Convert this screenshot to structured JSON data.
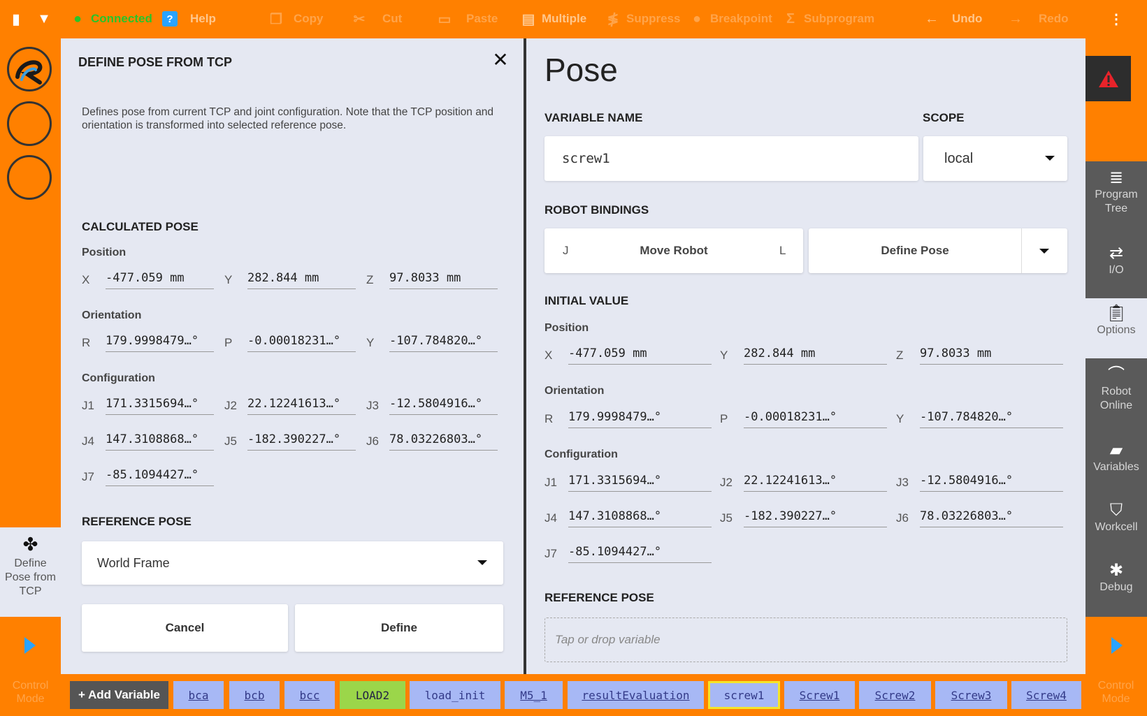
{
  "toolbar": {
    "connected": "Connected",
    "help": "Help",
    "copy": "Copy",
    "cut": "Cut",
    "paste": "Paste",
    "multiple": "Multiple",
    "suppress": "Suppress",
    "breakpoint": "Breakpoint",
    "subprogram": "Subprogram",
    "undo": "Undo",
    "redo": "Redo"
  },
  "left_rail": {
    "define_pose_label": "Define Pose from TCP",
    "control_mode": "Control Mode"
  },
  "dialog": {
    "title": "DEFINE POSE FROM TCP",
    "description": "Defines pose from current TCP and joint configuration. Note that the TCP position and orientation is transformed into selected reference pose.",
    "calculated_pose": "CALCULATED POSE",
    "position_label": "Position",
    "orientation_label": "Orientation",
    "configuration_label": "Configuration",
    "position": [
      {
        "label": "X",
        "value": "-477.059 mm"
      },
      {
        "label": "Y",
        "value": "282.844 mm"
      },
      {
        "label": "Z",
        "value": "97.8033 mm"
      }
    ],
    "orientation": [
      {
        "label": "R",
        "value": "179.9998479…°"
      },
      {
        "label": "P",
        "value": "-0.00018231…°"
      },
      {
        "label": "Y",
        "value": "-107.784820…°"
      }
    ],
    "configuration": [
      {
        "label": "J1",
        "value": "171.3315694…°"
      },
      {
        "label": "J2",
        "value": "22.12241613…°"
      },
      {
        "label": "J3",
        "value": "-12.5804916…°"
      },
      {
        "label": "J4",
        "value": "147.3108868…°"
      },
      {
        "label": "J5",
        "value": "-182.390227…°"
      },
      {
        "label": "J6",
        "value": "78.03226803…°"
      },
      {
        "label": "J7",
        "value": "-85.1094427…°"
      }
    ],
    "reference_pose_label": "REFERENCE POSE",
    "reference_pose_value": "World Frame",
    "cancel": "Cancel",
    "define": "Define"
  },
  "panel": {
    "title": "Pose",
    "variable_name_label": "VARIABLE NAME",
    "variable_name": "screw1",
    "scope_label": "SCOPE",
    "scope": "local",
    "robot_bindings_label": "ROBOT BINDINGS",
    "bind_j": "J",
    "move_robot": "Move Robot",
    "bind_l": "L",
    "define_pose": "Define Pose",
    "initial_value_label": "INITIAL VALUE",
    "position_label": "Position",
    "orientation_label": "Orientation",
    "configuration_label": "Configuration",
    "position": [
      {
        "label": "X",
        "value": "-477.059 mm"
      },
      {
        "label": "Y",
        "value": "282.844 mm"
      },
      {
        "label": "Z",
        "value": "97.8033 mm"
      }
    ],
    "orientation": [
      {
        "label": "R",
        "value": "179.9998479…°"
      },
      {
        "label": "P",
        "value": "-0.00018231…°"
      },
      {
        "label": "Y",
        "value": "-107.784820…°"
      }
    ],
    "configuration": [
      {
        "label": "J1",
        "value": "171.3315694…°"
      },
      {
        "label": "J2",
        "value": "22.12241613…°"
      },
      {
        "label": "J3",
        "value": "-12.5804916…°"
      },
      {
        "label": "J4",
        "value": "147.3108868…°"
      },
      {
        "label": "J5",
        "value": "-182.390227…°"
      },
      {
        "label": "J6",
        "value": "78.03226803…°"
      },
      {
        "label": "J7",
        "value": "-85.1094427…°"
      }
    ],
    "reference_pose_label": "REFERENCE POSE",
    "reference_pose_placeholder": "Tap or drop variable"
  },
  "right_rail": {
    "program_tree": "Program Tree",
    "io": "I/O",
    "options": "Options",
    "robot_online": "Robot Online",
    "variables": "Variables",
    "workcell": "Workcell",
    "debug": "Debug",
    "control_mode": "Control Mode"
  },
  "variables_bar": {
    "add_variable": "+ Add Variable",
    "chips": [
      "bca",
      "bcb",
      "bcc",
      "LOAD2",
      "load_init",
      "M5_1",
      "resultEvaluation",
      "screw1",
      "Screw1",
      "Screw2",
      "Screw3",
      "Screw4"
    ]
  },
  "colors": {
    "accent": "#ff8000",
    "panel_bg": "#e5e8f2",
    "chip": "#a7b8f5",
    "chip_green": "#9bd64a",
    "selected_border": "#f5e52a",
    "connected": "#29c429",
    "play": "#29a3ff"
  }
}
